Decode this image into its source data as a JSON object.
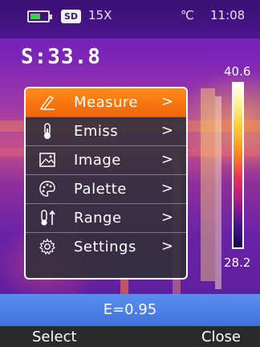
{
  "status": {
    "sd_badge": "SD",
    "zoom": "15X",
    "unit": "℃",
    "time": "11:08"
  },
  "spot_reading": "S:33.8",
  "scale": {
    "max": "40.6",
    "min": "28.2"
  },
  "menu": {
    "items": [
      {
        "label": "Measure",
        "icon": "measure-icon",
        "active": true
      },
      {
        "label": "Emiss",
        "icon": "thermometer-icon",
        "active": false
      },
      {
        "label": "Image",
        "icon": "image-icon",
        "active": false
      },
      {
        "label": "Palette",
        "icon": "palette-icon",
        "active": false
      },
      {
        "label": "Range",
        "icon": "range-icon",
        "active": false
      },
      {
        "label": "Settings",
        "icon": "gear-icon",
        "active": false
      }
    ],
    "chevron": ">"
  },
  "emissivity": "E=0.95",
  "softkeys": {
    "left": "Select",
    "right": "Close"
  },
  "colors": {
    "accent": "#f0650a",
    "emiss_bar": "#4a7fe6",
    "battery": "#39d24a"
  }
}
